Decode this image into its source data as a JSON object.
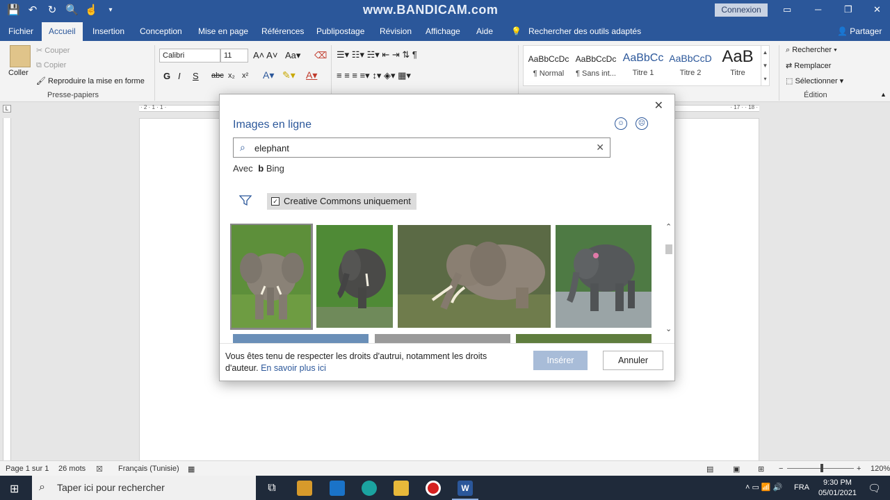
{
  "window": {
    "title": "www.BANDICAM.com",
    "connexion": "Connexion",
    "minimize": "─",
    "restore": "❐",
    "close": "✕"
  },
  "qat": {
    "save": "💾",
    "undo": "↶",
    "redo": "↻",
    "preview": "🔍",
    "touch": "☝",
    "more": "▾"
  },
  "menu": {
    "tabs": [
      "Fichier",
      "Accueil",
      "Insertion",
      "Conception",
      "Mise en page",
      "Références",
      "Publipostage",
      "Révision",
      "Affichage",
      "Aide"
    ],
    "active": "Accueil",
    "tellme": "Rechercher des outils adaptés",
    "share": "Partager"
  },
  "ribbon": {
    "clipboard": {
      "paste": "Coller",
      "cut": "Couper",
      "copy": "Copier",
      "painter": "Reproduire la mise en forme",
      "group": "Presse-papiers"
    },
    "font": {
      "name": "Calibri",
      "size": "11",
      "bold": "G",
      "italic": "I",
      "underline": "S",
      "strike": "abc",
      "sub": "x₂",
      "sup": "x²"
    },
    "styles": [
      {
        "sample": "AaBbCcDc",
        "name": "¶ Normal"
      },
      {
        "sample": "AaBbCcDc",
        "name": "¶ Sans int..."
      },
      {
        "sample": "AaBbCc",
        "name": "Titre 1"
      },
      {
        "sample": "AaBbCcD",
        "name": "Titre 2"
      },
      {
        "sample": "AaB",
        "name": "Titre"
      }
    ],
    "editing": {
      "find": "Rechercher",
      "replace": "Remplacer",
      "select": "Sélectionner",
      "group": "Édition"
    }
  },
  "ruler": {
    "left_marks": "· 2 · 1 · 1 ·",
    "right_marks": "· 17 · · 18 ·"
  },
  "dialog": {
    "title": "Images en ligne",
    "search_value": "elephant",
    "provider_prefix": "Avec",
    "provider_name": "Bing",
    "filter_label": "Creative Commons uniquement",
    "checkmark": "✓",
    "notice": "Vous êtes tenu de respecter les droits d'autrui, notamment les droits d'auteur.",
    "notice_link": "En savoir plus ici",
    "insert": "Insérer",
    "cancel": "Annuler",
    "close": "✕",
    "smile": "☺",
    "frown": "☹",
    "clear": "✕"
  },
  "status": {
    "page": "Page 1 sur 1",
    "words": "26 mots",
    "language": "Français (Tunisie)",
    "zoom": "120%",
    "minus": "−",
    "plus": "+"
  },
  "taskbar": {
    "search": "Taper ici pour rechercher",
    "time": "9:30 PM",
    "date": "05/01/2021",
    "lang": "FRA"
  }
}
